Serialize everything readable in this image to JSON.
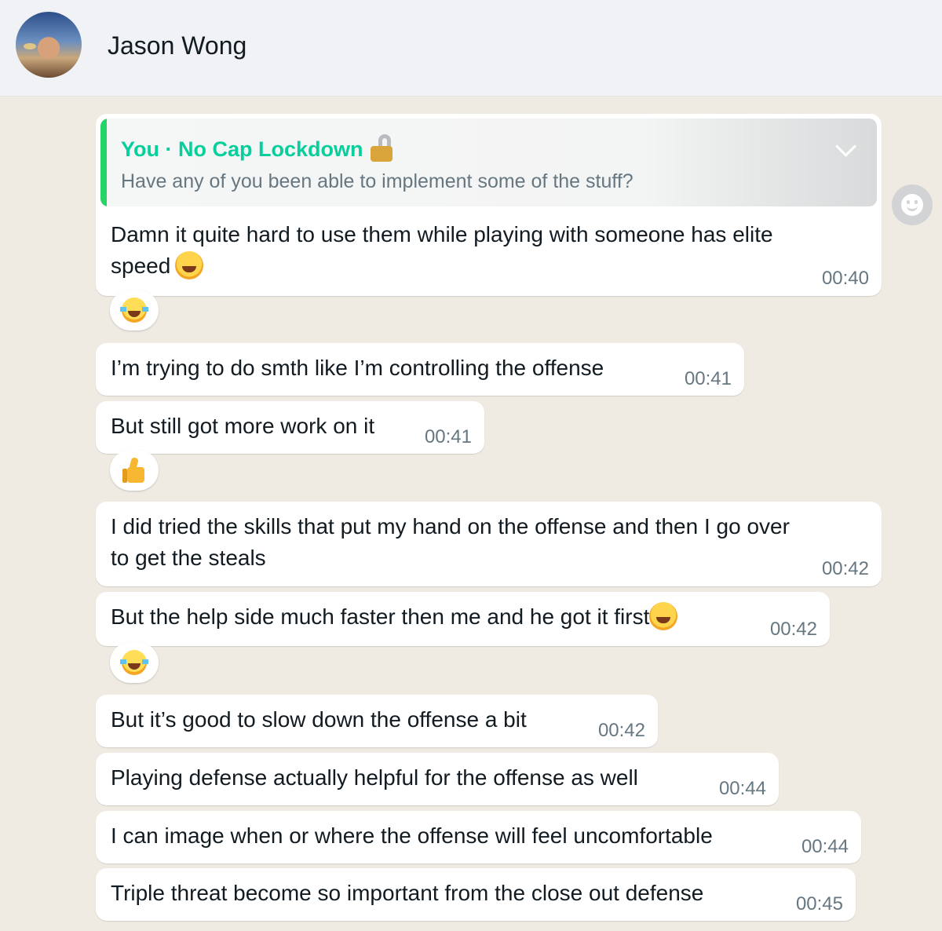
{
  "header": {
    "contact_name": "Jason Wong",
    "avatar_icon": "profile-photo"
  },
  "reply": {
    "author": "You · No Cap Lockdown",
    "author_icon": "lock-key-icon",
    "quoted_text": "Have any of you been able to implement some of the stuff?"
  },
  "messages": [
    {
      "line1": "Damn it quite hard to use them while playing with someone has elite",
      "line2": "speed",
      "emoji": "rofl",
      "time": "00:40",
      "reaction": "joy"
    },
    {
      "text": "I’m trying to do smth like I’m controlling the offense",
      "time": "00:41"
    },
    {
      "text": "But still got more work on it",
      "time": "00:41",
      "reaction": "thumbs-up"
    },
    {
      "line1": "I did tried the skills that put my hand on the offense and then I go over",
      "line2": "to get the steals",
      "time": "00:42"
    },
    {
      "text": "But the help side much faster then me and he got it first",
      "emoji": "rofl",
      "time": "00:42",
      "reaction": "joy"
    },
    {
      "text": "But it’s good to slow down the offense a bit",
      "time": "00:42"
    },
    {
      "text": "Playing defense actually helpful for the offense as well",
      "time": "00:44"
    },
    {
      "text": "I can image when or where the offense will feel uncomfortable",
      "time": "00:44"
    },
    {
      "text": "Triple threat become so important from the close out defense",
      "time": "00:45"
    }
  ],
  "colors": {
    "background": "#efeae2",
    "bubble": "#ffffff",
    "accent": "#06cf9c",
    "time": "#667781"
  }
}
